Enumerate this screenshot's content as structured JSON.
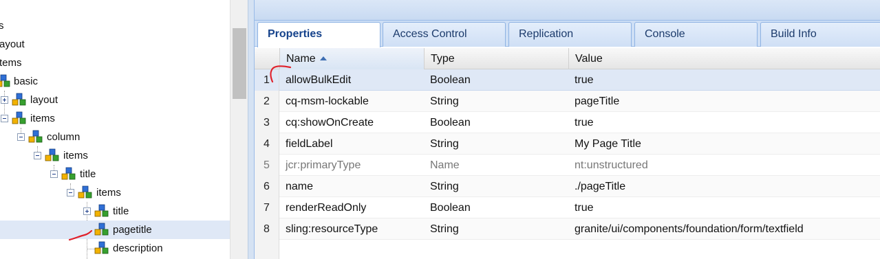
{
  "tree": {
    "nodes": [
      {
        "label": "s"
      },
      {
        "label": "ayout"
      },
      {
        "label": "tems"
      },
      {
        "label": "basic"
      },
      {
        "label": "layout"
      },
      {
        "label": "items"
      },
      {
        "label": "column"
      },
      {
        "label": "items"
      },
      {
        "label": "title"
      },
      {
        "label": "items"
      },
      {
        "label": "title"
      },
      {
        "label": "pagetitle",
        "selected": true
      },
      {
        "label": "description"
      }
    ]
  },
  "tabs": [
    {
      "label": "Properties",
      "active": true
    },
    {
      "label": "Access Control"
    },
    {
      "label": "Replication"
    },
    {
      "label": "Console"
    },
    {
      "label": "Build Info"
    }
  ],
  "grid": {
    "columns": {
      "name": "Name",
      "type": "Type",
      "value": "Value"
    },
    "rows": [
      {
        "num": "1",
        "name": "allowBulkEdit",
        "type": "Boolean",
        "value": "true"
      },
      {
        "num": "2",
        "name": "cq-msm-lockable",
        "type": "String",
        "value": "pageTitle"
      },
      {
        "num": "3",
        "name": "cq:showOnCreate",
        "type": "Boolean",
        "value": "true"
      },
      {
        "num": "4",
        "name": "fieldLabel",
        "type": "String",
        "value": "My Page Title"
      },
      {
        "num": "5",
        "name": "jcr:primaryType",
        "type": "Name",
        "value": "nt:unstructured"
      },
      {
        "num": "6",
        "name": "name",
        "type": "String",
        "value": "./pageTitle"
      },
      {
        "num": "7",
        "name": "renderReadOnly",
        "type": "Boolean",
        "value": "true"
      },
      {
        "num": "8",
        "name": "sling:resourceType",
        "type": "String",
        "value": "granite/ui/components/foundation/form/textfield"
      }
    ]
  },
  "colors": {
    "selection": "#dfe8f6",
    "tab_text": "#15428b",
    "annotation": "#e0202a"
  }
}
